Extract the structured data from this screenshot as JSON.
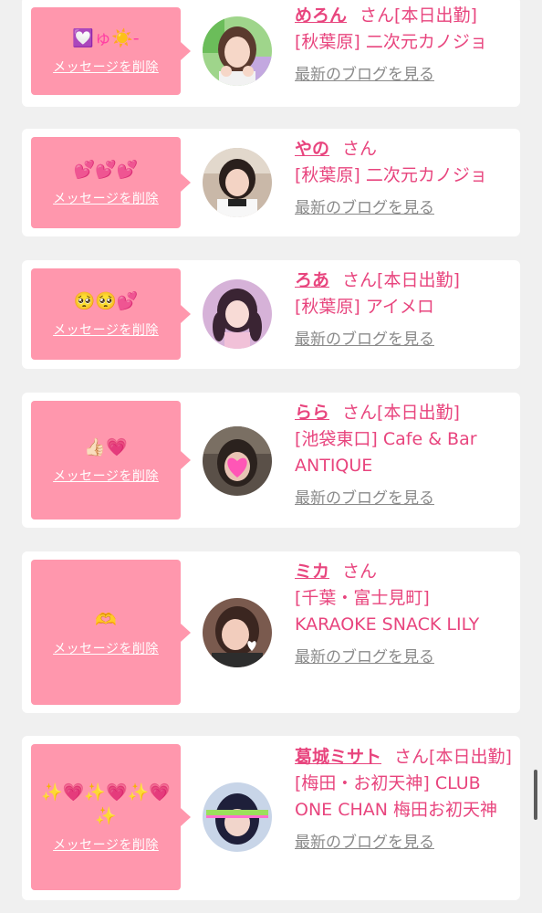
{
  "entries": [
    {
      "emoji": "💟ゅ☀️-",
      "delete_label": "メッセージを削除",
      "name": "めろん",
      "honorific": "さん",
      "status": "[本日出勤]",
      "shop": "[秋葉原] 二次元カノジョ",
      "blog_label": "最新のブログを見る"
    },
    {
      "emoji": "💕💕💕",
      "delete_label": "メッセージを削除",
      "name": "やの",
      "honorific": "さん",
      "status": "",
      "shop": "[秋葉原] 二次元カノジョ",
      "blog_label": "最新のブログを見る"
    },
    {
      "emoji": "🥺🥺💕",
      "delete_label": "メッセージを削除",
      "name": "ろあ",
      "honorific": "さん",
      "status": "[本日出勤]",
      "shop": "[秋葉原] アイメロ",
      "blog_label": "最新のブログを見る"
    },
    {
      "emoji": "👍🏻💗",
      "delete_label": "メッセージを削除",
      "name": "らら",
      "honorific": "さん",
      "status": "[本日出勤]",
      "shop": "[池袋東口] Cafe & Bar ANTIQUE",
      "blog_label": "最新のブログを見る"
    },
    {
      "emoji": "🫶",
      "delete_label": "メッセージを削除",
      "name": "ミカ",
      "honorific": "さん",
      "status": "",
      "shop": "[千葉・富士見町] KARAOKE SNACK LILY",
      "blog_label": "最新のブログを見る"
    },
    {
      "emoji": "✨💗✨💗✨💗✨",
      "delete_label": "メッセージを削除",
      "name": "葛城ミサト",
      "honorific": "さん",
      "status": "[本日出勤]",
      "shop": "[梅田・お初天神] CLUB ONE CHAN 梅田お初天神",
      "blog_label": "最新のブログを見る"
    }
  ],
  "colors": {
    "page_background": "#f0f0f0",
    "card_background": "#ffffff",
    "bubble": "#ff97ad",
    "name_text": "#e8457e",
    "blog_link": "#8a8a8a"
  }
}
